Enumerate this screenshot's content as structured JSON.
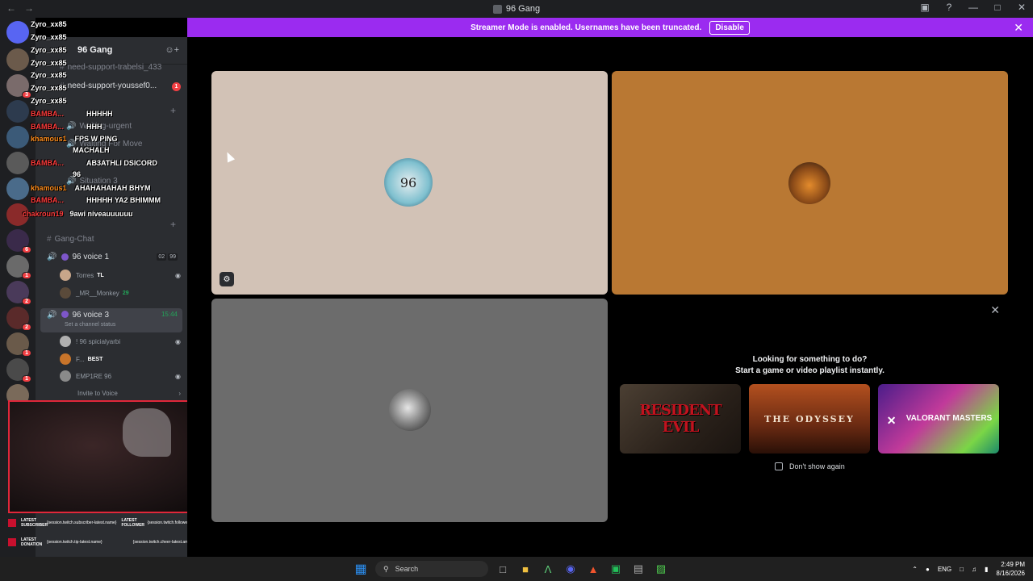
{
  "window": {
    "title": "96 Gang"
  },
  "banner": {
    "text": "Streamer Mode is enabled. Usernames have been truncated.",
    "disable_label": "Disable"
  },
  "server": {
    "name": "96 Gang"
  },
  "channels": [
    {
      "label": "need-support-trabelsi_433"
    },
    {
      "label": "need-support-youssef0...",
      "unread": "1"
    },
    {
      "label": "Waiting-urgent"
    },
    {
      "label": "Waiting For Move"
    },
    {
      "label": "Situation 3"
    },
    {
      "label": "Gang-Chat"
    }
  ],
  "voice": {
    "voice1": {
      "label": "96 voice 1",
      "pill1": "02",
      "pill2": "99"
    },
    "voice1_members": [
      {
        "name": "Torres",
        "tag": "TL"
      },
      {
        "name": "_MR__Monkey",
        "tag": "29"
      }
    ],
    "voice3": {
      "label": "96 voice 3",
      "timer": "15:44",
      "status": "Set a channel status"
    },
    "voice3_members": [
      {
        "name": "! 96 spicialyarbi",
        "tag": ""
      },
      {
        "name": "F...",
        "tag": "BEST"
      },
      {
        "name": "EMP1RE 96",
        "tag": ""
      }
    ],
    "invite_label": "Invite to Voice"
  },
  "chat_overlay": [
    {
      "name": "Zyro_xx85",
      "msg": "",
      "color": "w"
    },
    {
      "name": "Zyro_xx85",
      "msg": "",
      "color": "w"
    },
    {
      "name": "Zyro_xx85",
      "msg": "",
      "color": "w"
    },
    {
      "name": "Zyro_xx85",
      "msg": "",
      "color": "w"
    },
    {
      "name": "Zyro_xx85",
      "msg": "",
      "color": "w"
    },
    {
      "name": "Zyro_xx85",
      "msg": "",
      "color": "w"
    },
    {
      "name": "Zyro_xx85",
      "msg": "",
      "color": "w"
    },
    {
      "name": "BAMBA...",
      "msg": "HHHHH",
      "color": "r"
    },
    {
      "name": "BAMBA...",
      "msg": "HHH",
      "color": "r"
    },
    {
      "name": "khamous1",
      "msg": "FPS W PING",
      "color": "o"
    },
    {
      "name": "",
      "msg": "MACHALH",
      "color": "w"
    },
    {
      "name": "BAMBA...",
      "msg": "AB3ATHLI DSICORD",
      "color": "r"
    },
    {
      "name": "",
      "msg": "96",
      "color": "w"
    },
    {
      "name": "khamous1",
      "msg": "AHAHAHAHAH BHYM",
      "color": "o"
    },
    {
      "name": "BAMBA...",
      "msg": "HHHHH YA2 BHIMMM",
      "color": "r"
    },
    {
      "name": "chakroun19",
      "msg": "9awi niveauuuuuu",
      "color": "r"
    }
  ],
  "stream_alerts": [
    {
      "label": "LATEST SUBSCRIBER",
      "value": "{session.twitch.subscriber-latest.name}",
      "label2": "LATEST FOLLOWER",
      "value2": "{session.twitch.follower-latest.name}"
    },
    {
      "label": "LATEST DONATION",
      "value": "{session.twitch.tip-latest.name}",
      "label2": "",
      "value2": "{session.twitch.cheer-latest.amount}"
    }
  ],
  "activity": {
    "heading1": "Looking for something to do?",
    "heading2": "Start a game or video playlist instantly.",
    "cards": [
      {
        "title": "RESIDENT EVIL"
      },
      {
        "title": "THE ODYSSEY"
      },
      {
        "title": "VALORANT MASTERS"
      }
    ],
    "dont_show": "Don't show again"
  },
  "tiles": {
    "tile_a_text": "96"
  },
  "taskbar": {
    "search": "Search",
    "lang": "ENG",
    "time": "2:49 PM",
    "date": "8/16/2026"
  },
  "colors": {
    "banner": "#9b2bf0",
    "accent_green": "#23a559",
    "danger": "#f23f43"
  }
}
